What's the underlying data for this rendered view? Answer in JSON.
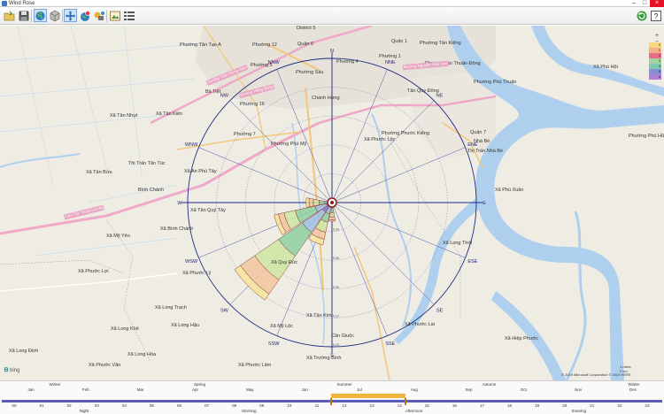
{
  "window": {
    "title": "Wind Rose"
  },
  "toolbar": {
    "left_icons": [
      "open-icon",
      "save-icon",
      "globe-icon",
      "cube-icon",
      "pan-icon",
      "globe-marker-icon",
      "layers-icon",
      "image-icon",
      "list-icon"
    ],
    "right_icons": [
      "refresh-icon",
      "help-icon"
    ]
  },
  "map": {
    "labels": [
      {
        "t": "Phường Tân Tạo A"
      },
      {
        "t": "Phường 12"
      },
      {
        "t": "Quận 6"
      },
      {
        "t": "Phường 5"
      },
      {
        "t": "Phường Tân Kiểng"
      },
      {
        "t": "Bà Tiệt"
      },
      {
        "t": "Phường 16"
      },
      {
        "t": "Phường Sáu"
      },
      {
        "t": "Xã Tân Kiên"
      },
      {
        "t": "Phường 7"
      },
      {
        "t": "Chánh Hưng"
      },
      {
        "t": "Tân Quy Đông"
      },
      {
        "t": "Phường Phú Thuận"
      },
      {
        "t": "Xã Tân Nhựt"
      },
      {
        "t": "Phường Phước Kiểng"
      },
      {
        "t": "Quận 7"
      },
      {
        "t": "Thị Trấn Tân Túc"
      },
      {
        "t": "Xã Phước Lộc"
      },
      {
        "t": "Nhà Bè"
      },
      {
        "t": "Xã Tân Bửu"
      },
      {
        "t": "Xã An Phú Tây"
      },
      {
        "t": "Phường Phú Mỹ"
      },
      {
        "t": "Thị Trấn Nhà Bè"
      },
      {
        "t": "Bình Chánh"
      },
      {
        "t": "Xã Phú Xuân"
      },
      {
        "t": "Xã Tân Quý Tây"
      },
      {
        "t": "Xã Bình Chánh"
      },
      {
        "t": "Xã Mỹ Yên"
      },
      {
        "t": "Xã Long Thới"
      },
      {
        "t": "Xã Quy Đức"
      },
      {
        "t": "Xã Phước Lý"
      },
      {
        "t": "Xã Phước Lợi"
      },
      {
        "t": "Xã Long Trạch"
      },
      {
        "t": "Xã Long Hậu"
      },
      {
        "t": "Xã Mỹ Lộc"
      },
      {
        "t": "Xã Tân Kim"
      },
      {
        "t": "Xã Phước Lai"
      },
      {
        "t": "Cần Giuộc"
      },
      {
        "t": "Xã Long Khê"
      },
      {
        "t": "Xã Long Hòa"
      },
      {
        "t": "Xã Trường Bình"
      },
      {
        "t": "Xã Phước Lâm"
      },
      {
        "t": "Xã Phước Vân"
      },
      {
        "t": "Xã Long Định"
      },
      {
        "t": "Xã Hiệp Phước"
      },
      {
        "t": "Quận 1"
      },
      {
        "t": "Phường 1"
      },
      {
        "t": "Xã Phú Hội"
      },
      {
        "t": "Phường Phú Hữu"
      },
      {
        "t": "Phường Tân Thuận Đông"
      },
      {
        "t": "District 5"
      },
      {
        "t": "Phường 4"
      }
    ],
    "road_labels": [
      "Đường Trần Hưng Đạo",
      "Đường Hồng Bàng",
      "Cao Tốc Trung Lương",
      "Đường Nguyễn Văn Linh"
    ],
    "directions": [
      "N",
      "NNE",
      "NE",
      "ENE",
      "E",
      "ESE",
      "SE",
      "SSE",
      "S",
      "SSW",
      "SW",
      "WSW",
      "W",
      "WNW",
      "NW",
      "NNW"
    ],
    "ring_labels": [
      "0.03",
      "0.06",
      "0.09",
      "0.12",
      "0.15"
    ],
    "legend": [
      "0",
      "1",
      "2",
      "3",
      "4",
      "5",
      "6"
    ],
    "legend_colors": [
      "#f6d97a",
      "#f3b08a",
      "#e56c8a",
      "#a0d3a0",
      "#7ec8b2",
      "#8a8ed6",
      "#b080d8"
    ],
    "zoom": [
      "+",
      "−",
      "⤢"
    ],
    "bing_text": "bing",
    "scale_text": "1 miles",
    "scale_text2": "2 km",
    "copyright": "© 2019 Microsoft Corporation  © 2019 HERE"
  },
  "timeline": {
    "seasons": [
      "Winter",
      "Spring",
      "Summer",
      "Autumn",
      "Winter"
    ],
    "months": [
      "Jan",
      "Feb",
      "Mar",
      "Apr",
      "May",
      "Jun",
      "Jul",
      "Aug",
      "Sep",
      "Oct",
      "Nov",
      "Dec"
    ],
    "hours": [
      "00",
      "01",
      "02",
      "03",
      "04",
      "05",
      "06",
      "07",
      "08",
      "09",
      "10",
      "11",
      "12",
      "13",
      "14",
      "15",
      "16",
      "17",
      "18",
      "19",
      "20",
      "21",
      "22",
      "23"
    ],
    "dayparts": [
      "Night",
      "Morning",
      "Afternoon",
      "Evening"
    ],
    "selection": {
      "start": "Jun",
      "end": "Aug"
    }
  }
}
